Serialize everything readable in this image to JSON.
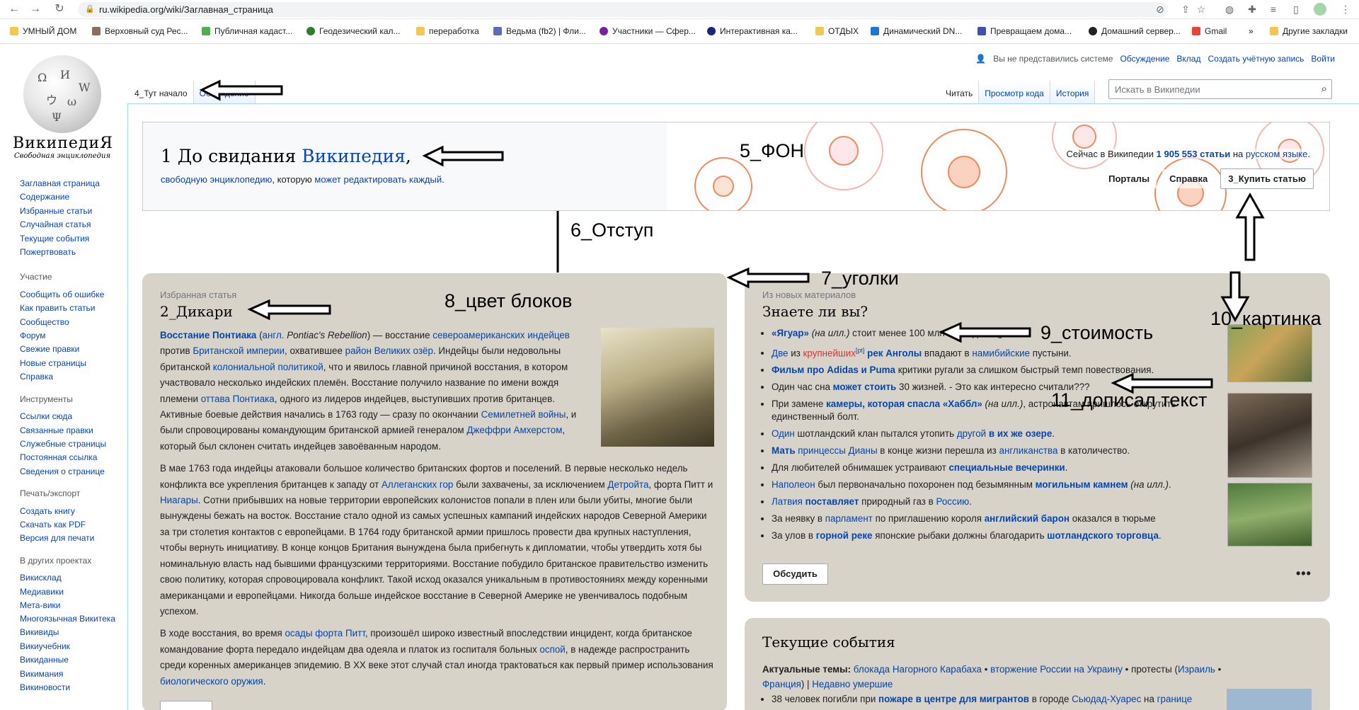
{
  "browser": {
    "url": "ru.wikipedia.org/wiki/Заглавная_страница",
    "bookmarks": [
      {
        "label": "УМНЫЙ ДОМ",
        "color": "#f2c94c"
      },
      {
        "label": "Верховный суд Рес...",
        "color": "#8d6e63"
      },
      {
        "label": "Публичная кадаст...",
        "color": "#4caf50"
      },
      {
        "label": "Геодезический кал...",
        "color": "#2e7d32"
      },
      {
        "label": "переработка",
        "color": "#f2c94c"
      },
      {
        "label": "Ведьма (fb2) | Фли...",
        "color": "#5c6bc0"
      },
      {
        "label": "Участники — Сфер...",
        "color": "#7b1fa2"
      },
      {
        "label": "Интерактивная ка...",
        "color": "#1a237e"
      },
      {
        "label": "ОТДЫХ",
        "color": "#f2c94c"
      },
      {
        "label": "Динамический DN...",
        "color": "#1976d2"
      },
      {
        "label": "Превращаем дома...",
        "color": "#3f51b5"
      },
      {
        "label": "Домашний сервер...",
        "color": "#212121"
      },
      {
        "label": "Gmail",
        "color": "#ea4335"
      },
      {
        "label": "»",
        "color": ""
      },
      {
        "label": "Другие закладки",
        "color": "#f2c94c"
      }
    ]
  },
  "logo": {
    "wordmark": "ВикипедиЯ",
    "tagline": "Свободная энциклопедия"
  },
  "sidebar": {
    "main": [
      "Заглавная страница",
      "Содержание",
      "Избранные статьи",
      "Случайная статья",
      "Текущие события",
      "Пожертвовать"
    ],
    "participation_title": "Участие",
    "participation": [
      "Сообщить об ошибке",
      "Как править статьи",
      "Сообщество",
      "Форум",
      "Свежие правки",
      "Новые страницы",
      "Справка"
    ],
    "tools_title": "Инструменты",
    "tools": [
      "Ссылки сюда",
      "Связанные правки",
      "Служебные страницы",
      "Постоянная ссылка",
      "Сведения о странице"
    ],
    "print_title": "Печать/экспорт",
    "print": [
      "Создать книгу",
      "Скачать как PDF",
      "Версия для печати"
    ],
    "projects_title": "В других проектах",
    "projects": [
      "Викисклад",
      "Медиавики",
      "Мета-вики",
      "Многоязычная Викитека",
      "Викивиды",
      "Викиучебник",
      "Викиданные",
      "Викимания",
      "Викиновости"
    ]
  },
  "user_links": {
    "anon": "Вы не представились системе",
    "talk": "Обсуждение",
    "contribs": "Вклад",
    "create": "Создать учётную запись",
    "login": "Войти"
  },
  "tabs": {
    "page": "4_Тут начало",
    "talk": "Обсуждение",
    "read": "Читать",
    "source": "Просмотр кода",
    "history": "История"
  },
  "search": {
    "placeholder": "Искать в Википедии"
  },
  "banner": {
    "title_prefix": "1 До свидания ",
    "title_link": "Википедия",
    "title_suffix": ",",
    "sub_link1": "свободную энциклопедию",
    "sub_mid": ", которую ",
    "sub_link2": "может редактировать каждый",
    "sub_end": ".",
    "count_prefix": "Сейчас в Википедии ",
    "count_link": "1 905 553 статьи",
    "count_mid": " на ",
    "count_lang": "русском языке",
    "count_end": ".",
    "btn_portals": "Порталы",
    "btn_help": "Справка",
    "btn_buy": "3_Купить статью"
  },
  "featured": {
    "kicker": "Избранная статья",
    "title": "2_Дикари",
    "p1_b": "Восстание Понтиака",
    "p1_a": " (",
    "p1_engl": "англ.",
    "p1_i": " Pontiac's Rebellion",
    "p1_b2": ") — восстание ",
    "p1_l1": "североамериканских индейцев",
    "p1_c": " против ",
    "p1_l2": "Британской империи",
    "p1_d": ", охватившее ",
    "p1_l3": "район Великих озёр",
    "p1_e": ". Индейцы были недовольны британской ",
    "p1_l4": "колониальной политикой",
    "p1_f": ", что и явилось главной причиной восстания, в котором участвовало несколько индейских племён. Восстание получило название по имени вождя племени ",
    "p1_l5": "оттава Понтиака",
    "p1_g": ", одного из лидеров индейцев, выступивших против британцев. Активные боевые действия начались в 1763 году — сразу по окончании ",
    "p1_l6": "Семилетней войны",
    "p1_h": ", и были спровоцированы командующим британской армией генералом ",
    "p1_l7": "Джеффри Амхерстом",
    "p1_i2": ", который был склонен считать индейцев завоёванным народом.",
    "p2_a": "В мае 1763 года индейцы атаковали большое количество британских фортов и поселений. В первые несколько недель конфликта все укрепления британцев к западу от ",
    "p2_l1": "Аллеганских гор",
    "p2_b": " были захвачены, за исключением ",
    "p2_l2": "Детройта",
    "p2_c": ", форта Питт и ",
    "p2_l3": "Ниагары",
    "p2_d": ". Сотни прибывших на новые территории европейских колонистов попали в плен или были убиты, многие были вынуждены бежать на восток. Восстание стало одной из самых успешных кампаний индейских народов Северной Америки за три столетия контактов с европейцами. В 1764 году британской армии пришлось провести два крупных наступления, чтобы вернуть инициативу. В конце концов Британия вынуждена была прибегнуть к дипломатии, чтобы утвердить хотя бы номинальную власть над бывшими французскими территориями. Восстание побудило британское правительство изменить свою политику, которая спровоцировала конфликт. Такой исход оказался уникальным в противостояниях между коренными американцами и европейцами. Никогда больше индейское восстание в Северной Америке не увенчивалось подобным успехом.",
    "p3_a": "В ходе восстания, во время ",
    "p3_l1": "осады форта Питт",
    "p3_b": ", произошёл широко известный впоследствии инцидент, когда британское командование форта передало индейцам два одеяла и платок из госпиталя больных ",
    "p3_l2": "оспой",
    "p3_c": ", в надежде распространить среди коренных американцев эпидемию. В XX веке этот случай стал иногда трактоваться как первый пример использования ",
    "p3_l3": "биологического оружия",
    "p3_d": "."
  },
  "dyk": {
    "kicker": "Из новых материалов",
    "title": "Знаете ли вы?",
    "i1_b": "«Ягуар»",
    "i1_i": " (на илл.)",
    "i1_t": " стоит менее 100 млн $ за единицу.",
    "i2_l1": "Две",
    "i2_t1": " из ",
    "i2_r": "крупнейших",
    "i2_sup": "[pt]",
    "i2_l2": "рек Анголы",
    "i2_t2": " впадают в ",
    "i2_l3": "намибийские",
    "i2_t3": " пустыни.",
    "i3_b": "Фильм про Adidas и Puma",
    "i3_t": " критики ругали за слишком быстрый темп повествования.",
    "i4_t1": "Один час сна ",
    "i4_b": "может стоить",
    "i4_t2": " 30 жизней. - Это как интересно считали???",
    "i5_t1": "При замене ",
    "i5_b": "камеры, которая спасла «Хаббл»",
    "i5_i": " (на илл.)",
    "i5_t2": ", астронавтам пришлось открутить единственный болт.",
    "i6_l1": "Один",
    "i6_t1": " шотландский клан пытался утопить ",
    "i6_l2": "другой",
    "i6_b": " в их же озере",
    "i6_t2": ".",
    "i7_b": "Мать",
    "i7_l1": " принцессы Дианы",
    "i7_t1": " в конце жизни перешла из ",
    "i7_l2": "англиканства",
    "i7_t2": " в католичество.",
    "i8_t1": "Для любителей обнимашек устраивают ",
    "i8_b": "специальные вечеринки",
    "i8_t2": ".",
    "i9_l1": "Наполеон",
    "i9_t1": " был первоначально похоронен под безымянным ",
    "i9_b": "могильным камнем",
    "i9_i": " (на илл.)",
    "i9_t2": ".",
    "i10_l1": "Латвия",
    "i10_b": " поставляет",
    "i10_t1": " природный газ в ",
    "i10_l2": "Россию",
    "i10_t2": ".",
    "i11_t1": "За неявку в ",
    "i11_l1": "парламент",
    "i11_t2": " по приглашению короля ",
    "i11_b": "английский барон",
    "i11_t3": " оказался в тюрьме",
    "i12_t1": "За улов в ",
    "i12_b1": "горной реке",
    "i12_t2": " японские рыбаки должны благодарить ",
    "i12_b2": "шотландского торговца",
    "i12_t3": ".",
    "discuss": "Обсудить",
    "more": "•••"
  },
  "news": {
    "title": "Текущие события",
    "topics_label": "Актуальные темы:",
    "t1": "блокада Нагорного Карабаха",
    "sep1": " • ",
    "t2": "вторжение России на Украину",
    "sep2": " • протесты (",
    "t3": "Израиль",
    "sep3": " • ",
    "t4": "Франция",
    "sep4": ") | ",
    "t5": "Недавно умершие",
    "n1_t1": "38 человек погибли при ",
    "n1_b": "пожаре в центре для мигрантов",
    "n1_t2": " в городе ",
    "n1_l1": "Сьюдад-Хуарес",
    "n1_t3": " на ",
    "n1_l2": "границе"
  },
  "annotations": {
    "a5": "5_ФОН",
    "a6": "6_Отступ",
    "a7": "7_уголки",
    "a8": "8_цвет блоков",
    "a9": "9_стоимость",
    "a10": "10_картинка",
    "a11": "11_дописал текст"
  },
  "colors": {
    "link": "#0645ad",
    "block": "#d7d3c9",
    "new_link": "#d33"
  }
}
